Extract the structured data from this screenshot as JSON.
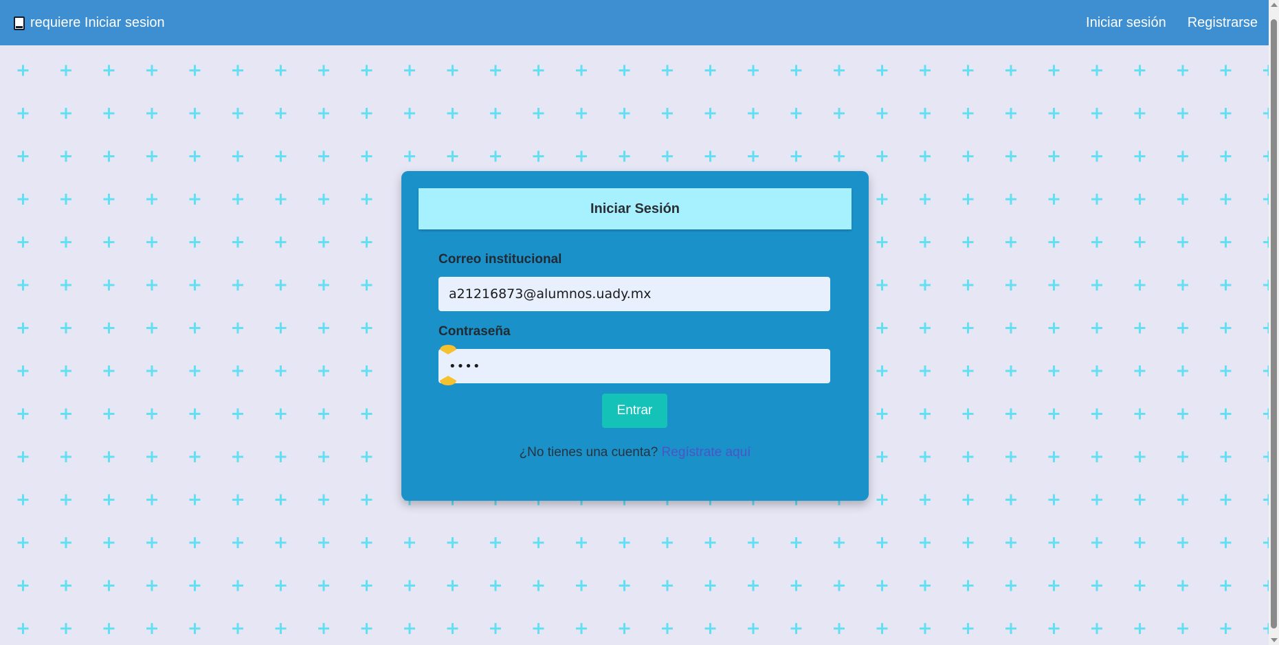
{
  "navbar": {
    "brand_icon": "book-icon",
    "brand_text": "requiere Iniciar sesion",
    "links": [
      {
        "label": "Iniciar sesión"
      },
      {
        "label": "Registrarse"
      }
    ],
    "color": "#3d8fd1"
  },
  "login": {
    "title": "Iniciar Sesión",
    "email_label": "Correo institucional",
    "email_value": "a21216873@alumnos.uady.mx",
    "password_label": "Contraseña",
    "password_value": "••••",
    "submit_label": "Entrar",
    "register_prompt": "¿No tienes una cuenta?",
    "register_link": "Regístrate aquí",
    "card_color": "#1a91c9",
    "header_color": "#a6f1fd",
    "button_color": "#14c2b8"
  },
  "background": {
    "color": "#e6e6f5",
    "pattern": "plus-signs",
    "pattern_color": "#62dff3"
  }
}
